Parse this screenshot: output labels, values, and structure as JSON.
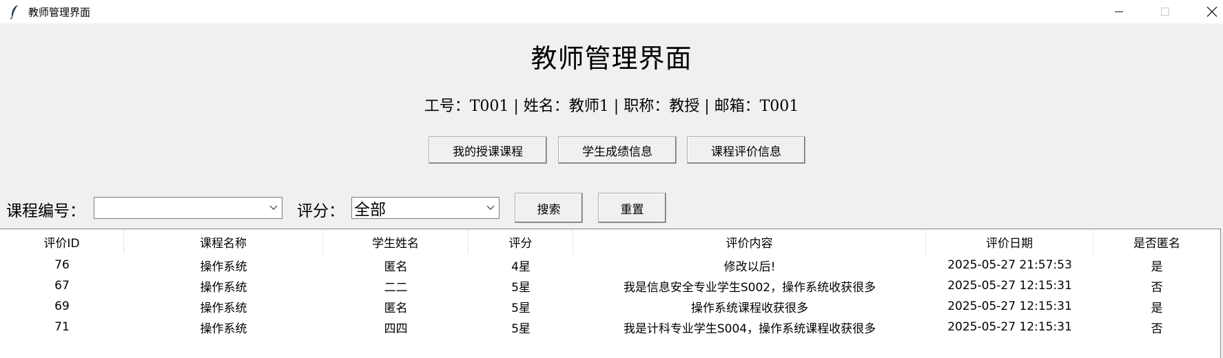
{
  "window": {
    "title": "教师管理界面",
    "icon": "feather-icon"
  },
  "header": {
    "title": "教师管理界面",
    "info": "工号：T001 | 姓名：教师1 | 职称：教授 | 邮箱：T001"
  },
  "nav_buttons": {
    "courses": "我的授课课程",
    "grades": "学生成绩信息",
    "evaluations": "课程评价信息"
  },
  "filters": {
    "course_label": "课程编号：",
    "course_value": "",
    "score_label": "评分：",
    "score_value": "全部",
    "search_label": "搜索",
    "reset_label": "重置"
  },
  "table": {
    "columns": [
      "评价ID",
      "课程名称",
      "学生姓名",
      "评分",
      "评价内容",
      "评价日期",
      "是否匿名"
    ],
    "rows": [
      [
        "76",
        "操作系统",
        "匿名",
        "4星",
        "修改以后!",
        "2025-05-27 21:57:53",
        "是"
      ],
      [
        "67",
        "操作系统",
        "二二",
        "5星",
        "我是信息安全专业学生S002，操作系统收获很多",
        "2025-05-27 12:15:31",
        "否"
      ],
      [
        "69",
        "操作系统",
        "匿名",
        "5星",
        "操作系统课程收获很多",
        "2025-05-27 12:15:31",
        "是"
      ],
      [
        "71",
        "操作系统",
        "四四",
        "5星",
        "我是计科专业学生S004，操作系统课程收获很多",
        "2025-05-27 12:15:31",
        "否"
      ]
    ]
  }
}
